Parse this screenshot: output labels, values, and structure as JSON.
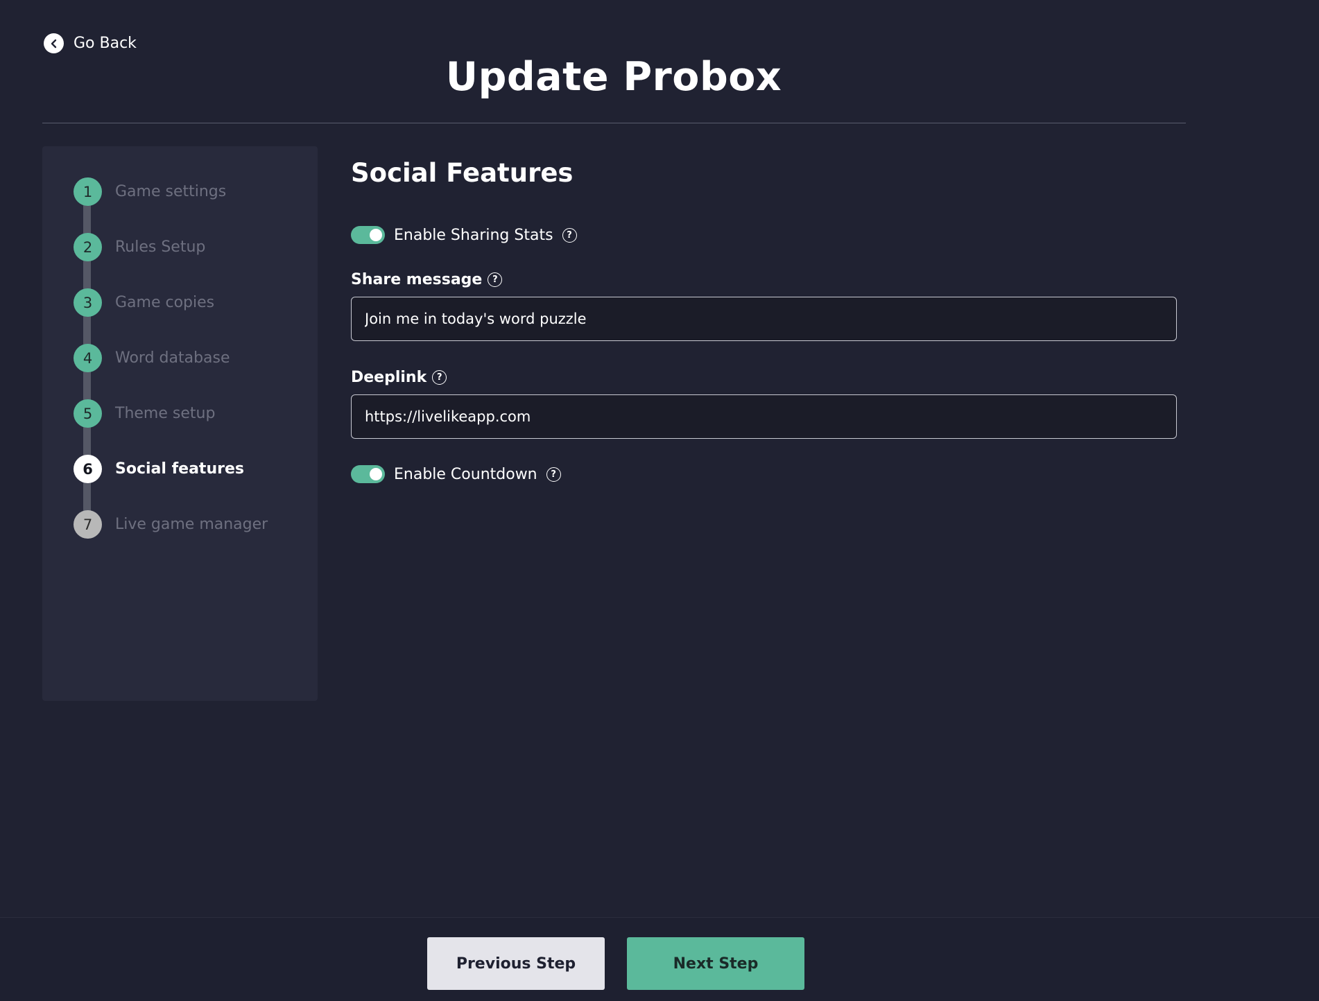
{
  "header": {
    "back_label": "Go Back",
    "title": "Update Probox"
  },
  "stepper": {
    "steps": [
      {
        "number": "1",
        "label": "Game settings",
        "state": "completed"
      },
      {
        "number": "2",
        "label": "Rules Setup",
        "state": "completed"
      },
      {
        "number": "3",
        "label": "Game copies",
        "state": "completed"
      },
      {
        "number": "4",
        "label": "Word database",
        "state": "completed"
      },
      {
        "number": "5",
        "label": "Theme setup",
        "state": "completed"
      },
      {
        "number": "6",
        "label": "Social features",
        "state": "current"
      },
      {
        "number": "7",
        "label": "Live game manager",
        "state": "pending"
      }
    ]
  },
  "main": {
    "section_title": "Social Features",
    "sharing_toggle": {
      "label": "Enable Sharing Stats",
      "enabled": true
    },
    "share_message": {
      "label": "Share message",
      "value": "Join me in today's word puzzle"
    },
    "deeplink": {
      "label": "Deeplink",
      "value": "https://livelikeapp.com"
    },
    "countdown_toggle": {
      "label": "Enable Countdown",
      "enabled": true
    },
    "help_glyph": "?"
  },
  "footer": {
    "prev_label": "Previous Step",
    "next_label": "Next Step"
  },
  "colors": {
    "background": "#202232",
    "sidebar": "#282a3c",
    "accent": "#5bb99b",
    "prev_button": "#e4e4ea"
  }
}
